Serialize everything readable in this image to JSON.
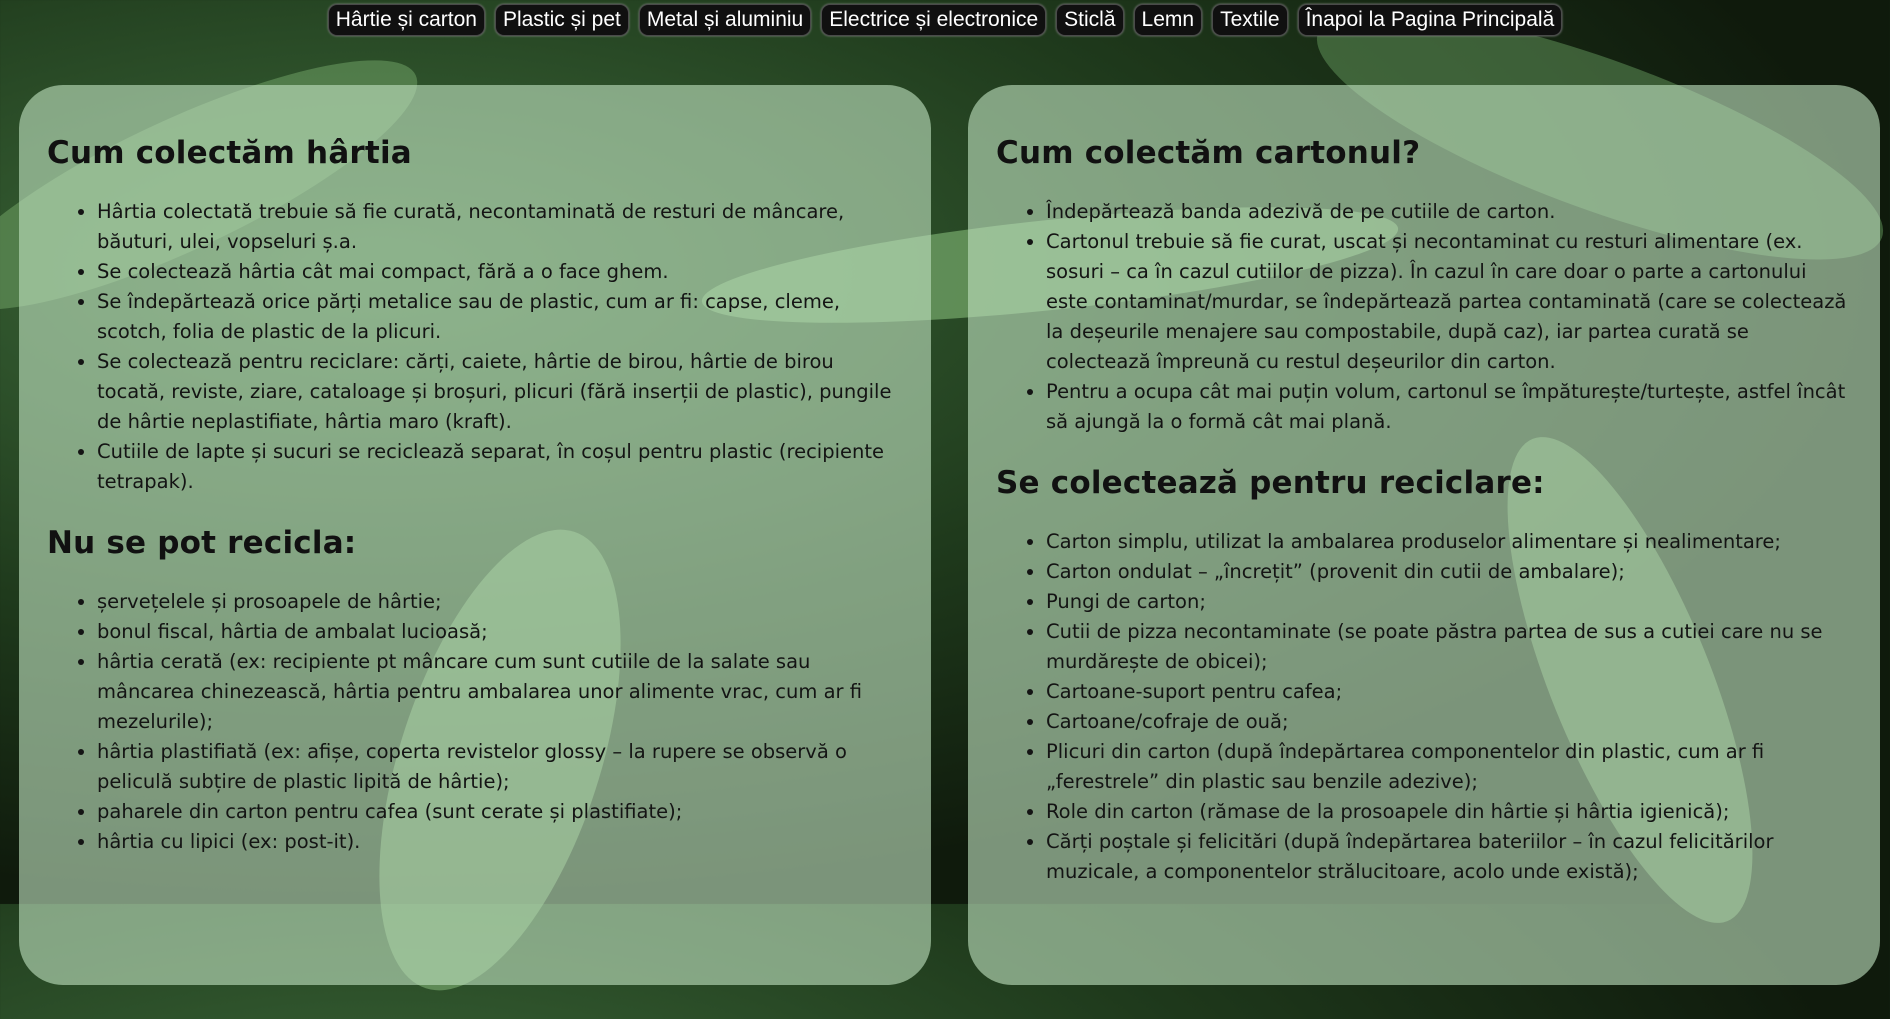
{
  "nav": {
    "items": [
      {
        "label": "Hârtie și carton"
      },
      {
        "label": "Plastic și pet"
      },
      {
        "label": "Metal și aluminiu"
      },
      {
        "label": "Electrice și electronice"
      },
      {
        "label": "Sticlă"
      },
      {
        "label": "Lemn"
      },
      {
        "label": "Textile"
      },
      {
        "label": "Înapoi la Pagina Principală"
      }
    ]
  },
  "left": {
    "heading1": "Cum colectăm hârtia",
    "list1": [
      "Hârtia colectată trebuie să fie curată, necontaminată de resturi de mâncare, băuturi, ulei, vopseluri ș.a.",
      "Se colectează hârtia cât mai compact, fără a o face ghem.",
      "Se îndepărtează orice părți metalice sau de plastic, cum ar fi: capse, cleme, scotch, folia de plastic de la plicuri.",
      "Se colectează pentru reciclare: cărți, caiete, hârtie de birou, hârtie de birou tocată, reviste, ziare, cataloage și broșuri, plicuri (fără inserții de plastic), pungile de hârtie neplastifiate, hârtia maro (kraft).",
      "Cutiile de lapte și sucuri se reciclează separat, în coșul pentru plastic (recipiente tetrapak)."
    ],
    "heading2": "Nu se pot recicla:",
    "list2": [
      "șervețelele și prosoapele de hârtie;",
      "bonul fiscal, hârtia de ambalat lucioasă;",
      "hârtia cerată (ex: recipiente pt mâncare cum sunt cutiile de la salate sau mâncarea chinezească, hârtia pentru ambalarea unor alimente vrac, cum ar fi mezelurile);",
      "hârtia plastifiată (ex: afișe, coperta revistelor glossy – la rupere se observă o peliculă subțire de plastic lipită de hârtie);",
      "paharele din carton pentru cafea (sunt cerate și plastifiate);",
      "hârtia cu lipici (ex: post-it)."
    ]
  },
  "right": {
    "heading1": "Cum colectăm cartonul?",
    "list1": [
      "Îndepărtează banda adezivă de pe cutiile de carton.",
      "Cartonul trebuie să fie curat, uscat și necontaminat cu resturi alimentare (ex. sosuri – ca în cazul cutiilor de pizza). În cazul în care doar o parte a cartonului este contaminat/murdar, se îndepărtează partea contaminată (care se colectează la deșeurile menajere sau compostabile, după caz), iar partea curată se colectează împreună cu restul deșeurilor din carton.",
      "Pentru a ocupa cât mai puțin volum, cartonul se împăturește/turtește, astfel încât să ajungă la o formă cât mai plană."
    ],
    "heading2": "Se colectează pentru reciclare:",
    "list2": [
      "Carton simplu, utilizat la ambalarea produselor alimentare și nealimentare;",
      "Carton ondulat – „încrețit” (provenit din cutii de ambalare);",
      "Pungi de carton;",
      "Cutii de pizza necontaminate (se poate păstra partea de sus a cutiei care nu se murdărește de obicei);",
      "Cartoane-suport pentru cafea;",
      "Cartoane/cofraje de ouă;",
      "Plicuri din carton (după îndepărtarea componentelor din plastic, cum ar fi „ferestrele” din plastic sau benzile adezive);",
      "Role din carton (rămase de la prosoapele din hârtie și hârtia igienică);",
      "Cărți poștale și felicitări (după îndepărtarea bateriilor – în cazul felicitărilor muzicale, a componentelor strălucitoare, acolo unde există);"
    ]
  }
}
